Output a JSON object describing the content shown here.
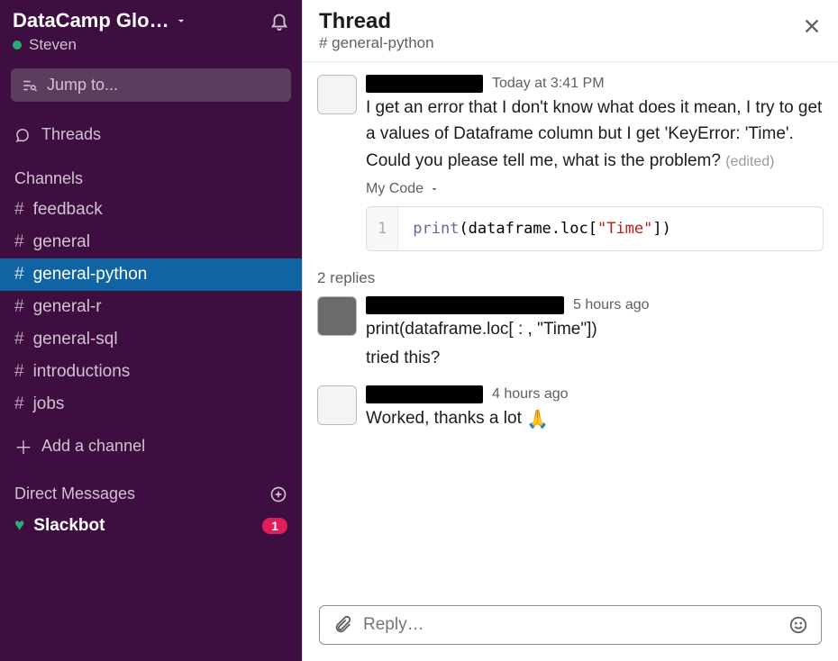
{
  "sidebar": {
    "workspace": "DataCamp Glo…",
    "user": "Steven",
    "jump_placeholder": "Jump to...",
    "threads_label": "Threads",
    "channels_heading": "Channels",
    "channels": [
      {
        "name": "feedback",
        "active": false
      },
      {
        "name": "general",
        "active": false
      },
      {
        "name": "general-python",
        "active": true
      },
      {
        "name": "general-r",
        "active": false
      },
      {
        "name": "general-sql",
        "active": false
      },
      {
        "name": "introductions",
        "active": false
      },
      {
        "name": "jobs",
        "active": false
      }
    ],
    "add_channel": "Add a channel",
    "dm_heading": "Direct Messages",
    "slackbot": {
      "label": "Slackbot",
      "badge": "1"
    }
  },
  "thread": {
    "title": "Thread",
    "channel": "# general-python",
    "original": {
      "name_redact_w": 130,
      "timestamp": "Today at 3:41 PM",
      "text": "I get an error that I don't know what does it mean, I try to get a values of Dataframe column but I get 'KeyError: 'Time'. Could you please tell me, what is the problem?",
      "edited": "(edited)",
      "code_label": "My Code",
      "code_line_no": "1",
      "code_fn": "print",
      "code_mid": "(dataframe.loc[",
      "code_str": "\"Time\"",
      "code_end": "])"
    },
    "replies_label": "2 replies",
    "replies": [
      {
        "name_redact_w": 220,
        "timestamp": "5 hours ago",
        "line1": "print(dataframe.loc[ : , \"Time\"])",
        "line2": "tried this?",
        "avatar": "dark"
      },
      {
        "name_redact_w": 130,
        "timestamp": "4 hours ago",
        "line1": "Worked, thanks a lot ",
        "emoji": "🙏",
        "avatar": ""
      }
    ],
    "reply_placeholder": "Reply…"
  }
}
